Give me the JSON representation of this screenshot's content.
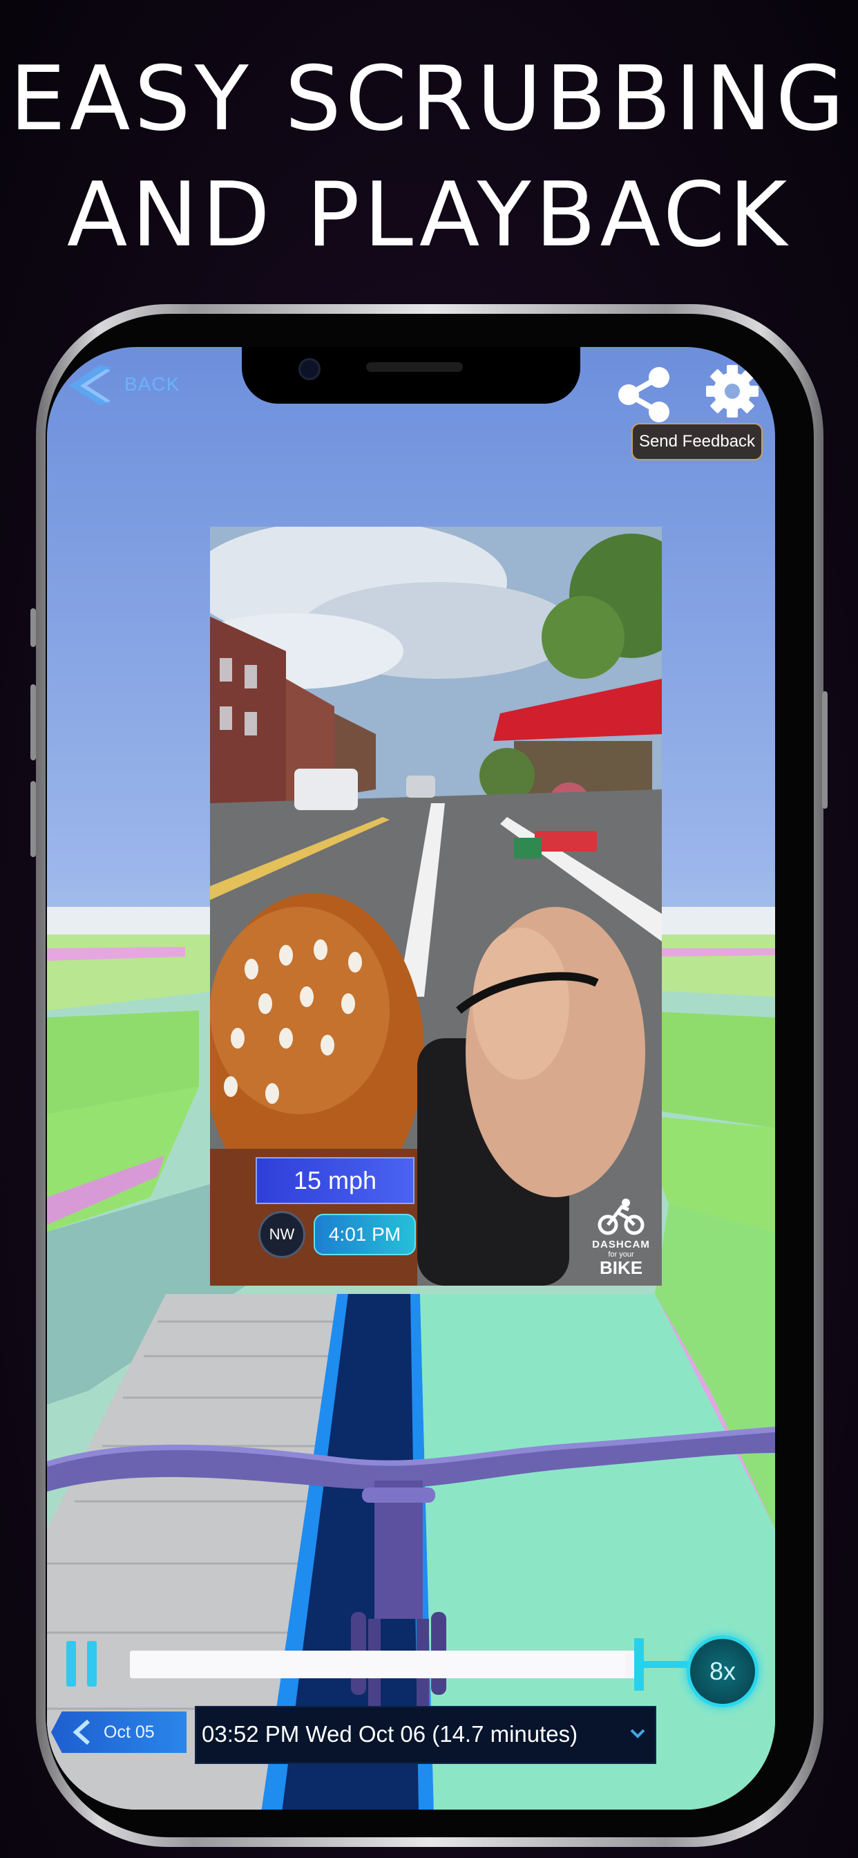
{
  "headline": {
    "line1": "EASY SCRUBBING",
    "line2": "AND PLAYBACK"
  },
  "top_bar": {
    "back_label": "BACK",
    "back_icon": "chevron-left-icon",
    "share_icon": "share-icon",
    "settings_icon": "gear-icon",
    "feedback_label": "Send Feedback"
  },
  "video": {
    "speed": "15 mph",
    "heading": "NW",
    "time": "4:01 PM",
    "logo": {
      "line1": "DASHCAM",
      "line2": "for your",
      "line3": "BIKE"
    }
  },
  "playback": {
    "pause_icon": "pause-icon",
    "progress": 0.97,
    "rate_label": "8x",
    "prev_date_label": "Oct 05",
    "current_label": "03:52 PM Wed Oct 06 (14.7 minutes)"
  },
  "colors": {
    "accent": "#27d1ee",
    "link": "#6ab2ff",
    "date_button": "#2a86ea"
  }
}
